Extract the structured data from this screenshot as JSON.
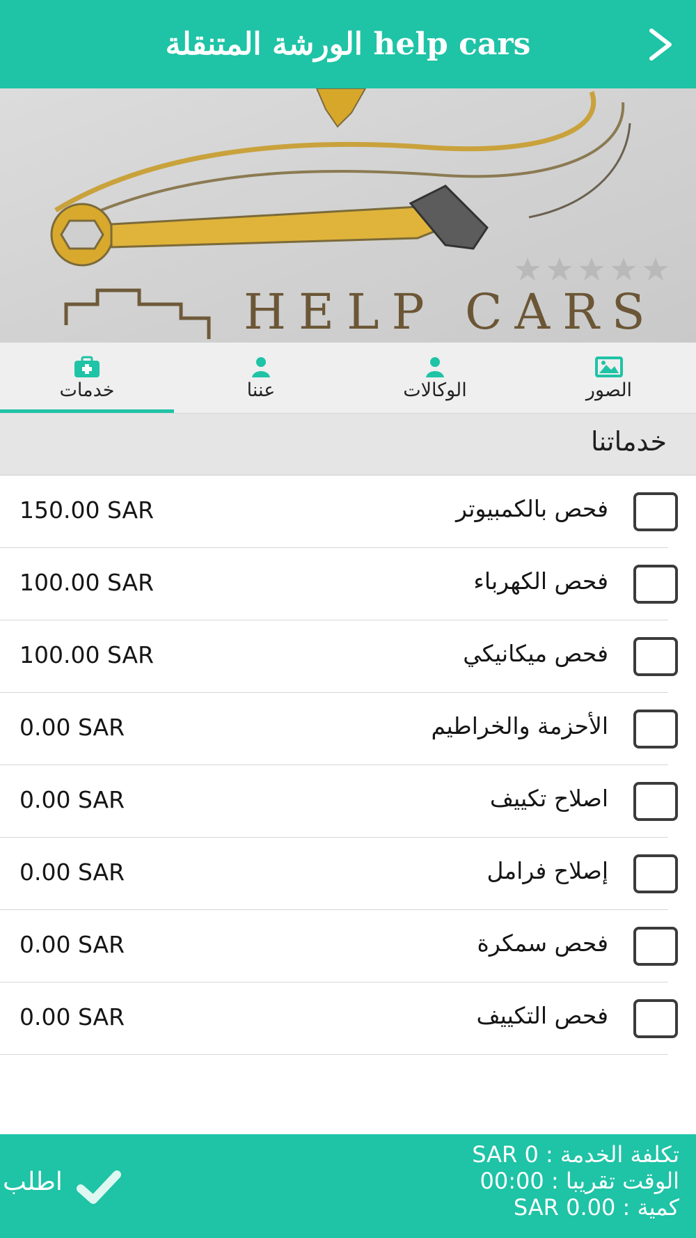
{
  "header": {
    "title": "الورشة المتنقلة help cars",
    "back_icon": "chevron-right-icon"
  },
  "banner": {
    "brand_text": "HELP CARS",
    "rating": {
      "value": 0,
      "max": 5
    }
  },
  "tabs": [
    {
      "label": "الصور",
      "icon": "image-icon",
      "active": false
    },
    {
      "label": "الوكالات",
      "icon": "person-icon",
      "active": false
    },
    {
      "label": "عننا",
      "icon": "person-icon",
      "active": false
    },
    {
      "label": "خدمات",
      "icon": "medkit-icon",
      "active": true
    }
  ],
  "section": {
    "title": "خدماتنا"
  },
  "services": [
    {
      "name": "فحص بالكمبيوتر",
      "price": "150.00 SAR",
      "checked": false
    },
    {
      "name": "فحص الكهرباء",
      "price": "100.00 SAR",
      "checked": false
    },
    {
      "name": "فحص ميكانيكي",
      "price": "100.00 SAR",
      "checked": false
    },
    {
      "name": "الأحزمة والخراطيم",
      "price": "0.00 SAR",
      "checked": false
    },
    {
      "name": "اصلاح تكييف",
      "price": "0.00 SAR",
      "checked": false
    },
    {
      "name": "إصلاح فرامل",
      "price": "0.00 SAR",
      "checked": false
    },
    {
      "name": "فحص سمكرة",
      "price": "0.00 SAR",
      "checked": false
    },
    {
      "name": "فحص التكييف",
      "price": "0.00 SAR",
      "checked": false
    }
  ],
  "footer": {
    "order_label": "اطلب",
    "order_icon": "checkmark-icon",
    "cost_line": "تكلفة الخدمة : SAR 0",
    "time_line": "الوقت تقريبا : 00:00",
    "amount_line": "كمية : SAR 0.00"
  },
  "colors": {
    "accent": "#1fc3a6",
    "section_bg": "#e5e5e5",
    "tab_bg": "#efefef"
  }
}
